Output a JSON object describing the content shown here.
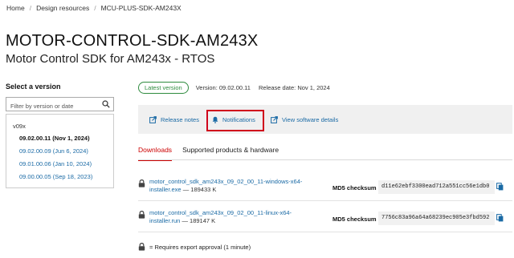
{
  "breadcrumb": [
    "Home",
    "Design resources",
    "MCU-PLUS-SDK-AM243X"
  ],
  "header": {
    "title": "MOTOR-CONTROL-SDK-AM243X",
    "subtitle": "Motor Control SDK for AM243x - RTOS"
  },
  "sidebar": {
    "label": "Select a version",
    "filter_placeholder": "Filter by version or date",
    "group": "v09x",
    "versions": [
      "09.02.00.11 (Nov 1, 2024)",
      "09.02.00.09 (Jun 6, 2024)",
      "09.01.00.06 (Jan 10, 2024)",
      "09.00.00.05 (Sep 18, 2023)"
    ]
  },
  "meta": {
    "badge": "Latest version",
    "version": "Version: 09.02.00.11",
    "release_date": "Release date: Nov 1, 2024"
  },
  "actions": {
    "release_notes": "Release notes",
    "notifications": "Notifications",
    "view_details": "View software details"
  },
  "tabs": [
    "Downloads",
    "Supported products & hardware"
  ],
  "files": [
    {
      "name_line1": "motor_control_sdk_am243x_09_02_00_11-windows-x64-",
      "name_line2": "installer.exe",
      "size": " — 189433 K",
      "md5_label": "MD5 checksum",
      "md5": "d11e62ebf3300ead712a551cc56e1db0"
    },
    {
      "name_line1": "motor_control_sdk_am243x_09_02_00_11-linux-x64-",
      "name_line2": "installer.run",
      "size": " — 189147 K",
      "md5_label": "MD5 checksum",
      "md5": "7756c83a96a64a68239ec905e3fbd592"
    }
  ],
  "footnote": "= Requires export approval (1 minute)",
  "colors": {
    "link": "#1a6aa5",
    "accent_red": "#cc0000",
    "highlight_box": "#d0021b",
    "badge_green": "#2e8b3e"
  }
}
